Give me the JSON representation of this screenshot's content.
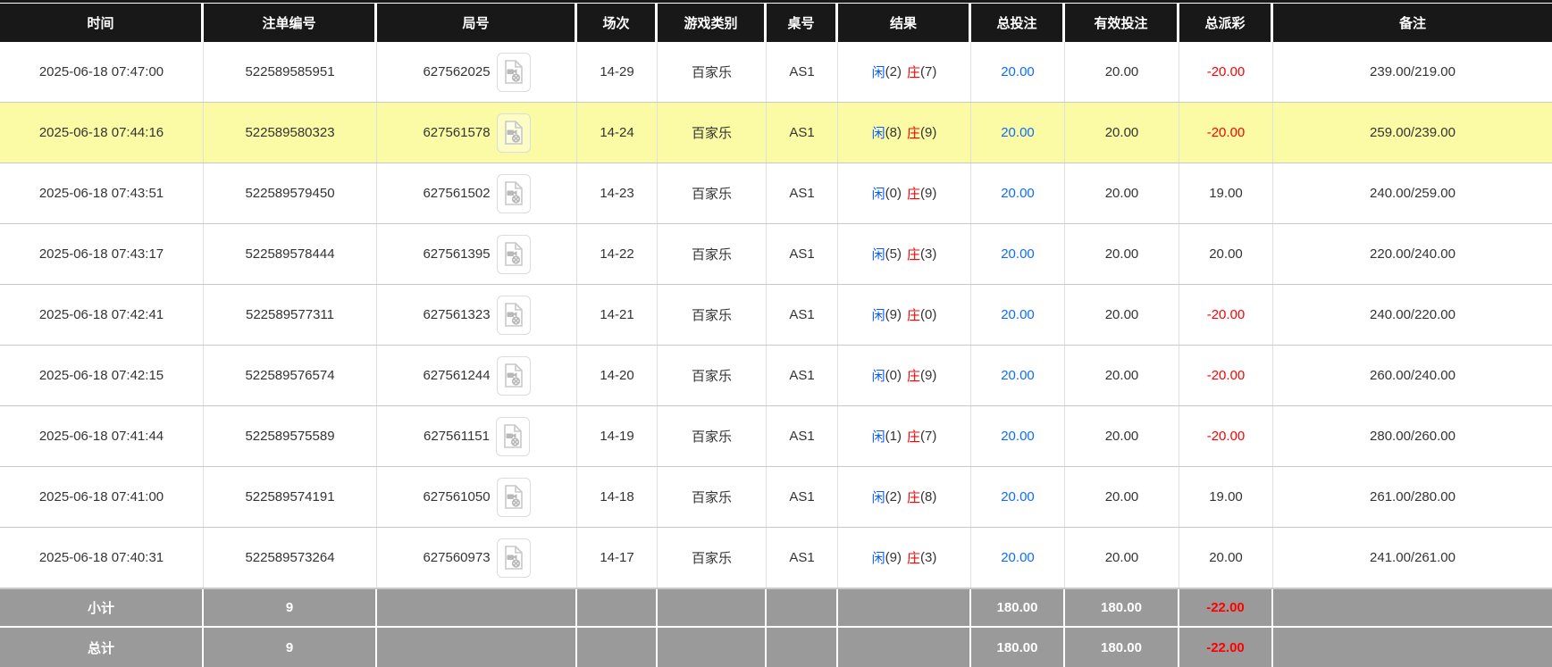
{
  "colors": {
    "header_bg": "#181818",
    "row_highlight": "#fbfba5",
    "footer_bg": "#9a9a9a",
    "player_blue": "#0b5cff",
    "banker_red": "#ff0000",
    "amount_link_blue": "#0b6cff",
    "negative_red": "#ff0000"
  },
  "header": {
    "columns": [
      "时间",
      "注单编号",
      "局号",
      "场次",
      "游戏类别",
      "桌号",
      "结果",
      "总投注",
      "有效投注",
      "总派彩",
      "备注"
    ]
  },
  "icons": {
    "video_replay": "video-file-icon"
  },
  "rows": [
    {
      "time": "2025-06-18 07:47:00",
      "bet_id": "522589585951",
      "round_id": "627562025",
      "session": "14-29",
      "game": "百家乐",
      "table": "AS1",
      "result": {
        "p": "闲",
        "pv": "(2)",
        "b": "庄",
        "bv": "(7)"
      },
      "total_bet": "20.00",
      "valid_bet": "20.00",
      "payout": "-20.00",
      "remark": "239.00/219.00"
    },
    {
      "time": "2025-06-18 07:44:16",
      "bet_id": "522589580323",
      "round_id": "627561578",
      "session": "14-24",
      "game": "百家乐",
      "table": "AS1",
      "result": {
        "p": "闲",
        "pv": "(8)",
        "b": "庄",
        "bv": "(9)"
      },
      "total_bet": "20.00",
      "valid_bet": "20.00",
      "payout": "-20.00",
      "remark": "259.00/239.00"
    },
    {
      "time": "2025-06-18 07:43:51",
      "bet_id": "522589579450",
      "round_id": "627561502",
      "session": "14-23",
      "game": "百家乐",
      "table": "AS1",
      "result": {
        "p": "闲",
        "pv": "(0)",
        "b": "庄",
        "bv": "(9)"
      },
      "total_bet": "20.00",
      "valid_bet": "20.00",
      "payout": "19.00",
      "remark": "240.00/259.00"
    },
    {
      "time": "2025-06-18 07:43:17",
      "bet_id": "522589578444",
      "round_id": "627561395",
      "session": "14-22",
      "game": "百家乐",
      "table": "AS1",
      "result": {
        "p": "闲",
        "pv": "(5)",
        "b": "庄",
        "bv": "(3)"
      },
      "total_bet": "20.00",
      "valid_bet": "20.00",
      "payout": "20.00",
      "remark": "220.00/240.00"
    },
    {
      "time": "2025-06-18 07:42:41",
      "bet_id": "522589577311",
      "round_id": "627561323",
      "session": "14-21",
      "game": "百家乐",
      "table": "AS1",
      "result": {
        "p": "闲",
        "pv": "(9)",
        "b": "庄",
        "bv": "(0)"
      },
      "total_bet": "20.00",
      "valid_bet": "20.00",
      "payout": "-20.00",
      "remark": "240.00/220.00"
    },
    {
      "time": "2025-06-18 07:42:15",
      "bet_id": "522589576574",
      "round_id": "627561244",
      "session": "14-20",
      "game": "百家乐",
      "table": "AS1",
      "result": {
        "p": "闲",
        "pv": "(0)",
        "b": "庄",
        "bv": "(9)"
      },
      "total_bet": "20.00",
      "valid_bet": "20.00",
      "payout": "-20.00",
      "remark": "260.00/240.00"
    },
    {
      "time": "2025-06-18 07:41:44",
      "bet_id": "522589575589",
      "round_id": "627561151",
      "session": "14-19",
      "game": "百家乐",
      "table": "AS1",
      "result": {
        "p": "闲",
        "pv": "(1)",
        "b": "庄",
        "bv": "(7)"
      },
      "total_bet": "20.00",
      "valid_bet": "20.00",
      "payout": "-20.00",
      "remark": "280.00/260.00"
    },
    {
      "time": "2025-06-18 07:41:00",
      "bet_id": "522589574191",
      "round_id": "627561050",
      "session": "14-18",
      "game": "百家乐",
      "table": "AS1",
      "result": {
        "p": "闲",
        "pv": "(2)",
        "b": "庄",
        "bv": "(8)"
      },
      "total_bet": "20.00",
      "valid_bet": "20.00",
      "payout": "19.00",
      "remark": "261.00/280.00"
    },
    {
      "time": "2025-06-18 07:40:31",
      "bet_id": "522589573264",
      "round_id": "627560973",
      "session": "14-17",
      "game": "百家乐",
      "table": "AS1",
      "result": {
        "p": "闲",
        "pv": "(9)",
        "b": "庄",
        "bv": "(3)"
      },
      "total_bet": "20.00",
      "valid_bet": "20.00",
      "payout": "20.00",
      "remark": "241.00/261.00"
    }
  ],
  "footer": {
    "subtotal": {
      "label": "小计",
      "count": "9",
      "total_bet": "180.00",
      "valid_bet": "180.00",
      "payout": "-22.00"
    },
    "grandtotal": {
      "label": "总计",
      "count": "9",
      "total_bet": "180.00",
      "valid_bet": "180.00",
      "payout": "-22.00"
    }
  }
}
